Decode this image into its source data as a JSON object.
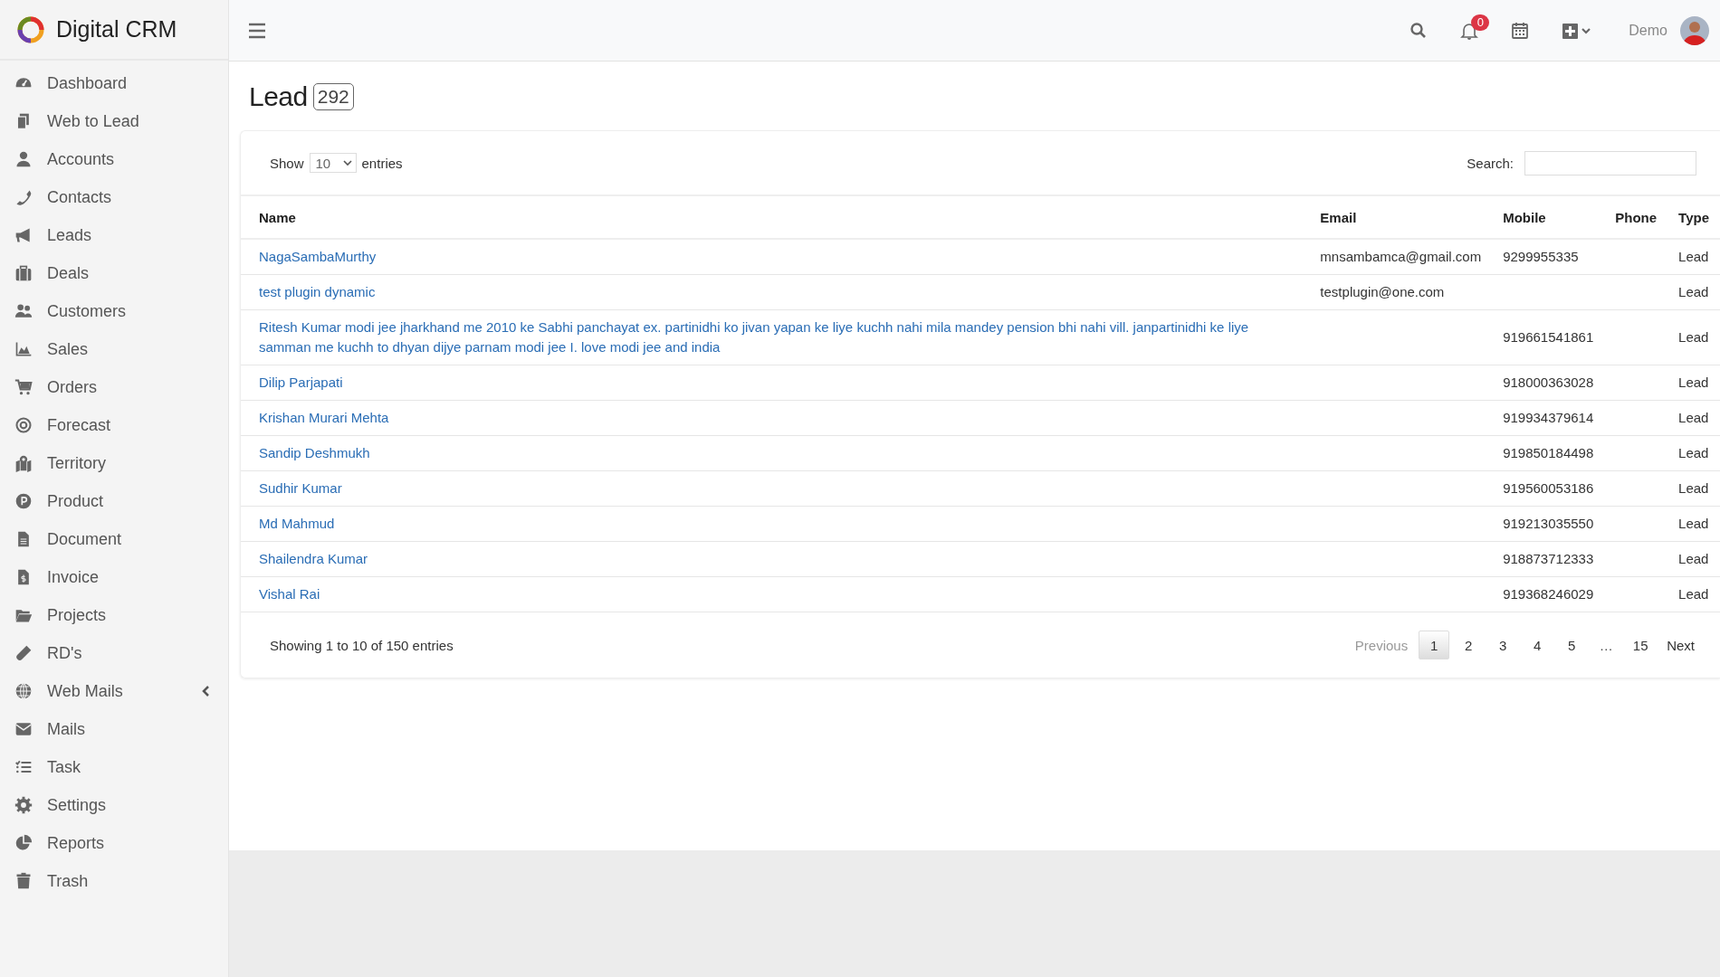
{
  "brand": {
    "title": "Digital CRM"
  },
  "sidebar": {
    "items": [
      {
        "label": "Dashboard",
        "kind": "link"
      },
      {
        "label": "Web to Lead",
        "kind": "link"
      },
      {
        "label": "Accounts",
        "kind": "link"
      },
      {
        "label": "Contacts",
        "kind": "link"
      },
      {
        "label": "Leads",
        "kind": "link"
      },
      {
        "label": "Deals",
        "kind": "link"
      },
      {
        "label": "Customers",
        "kind": "link"
      },
      {
        "label": "Sales",
        "kind": "link"
      },
      {
        "label": "Orders",
        "kind": "link"
      },
      {
        "label": "Forecast",
        "kind": "link"
      },
      {
        "label": "Territory",
        "kind": "link"
      },
      {
        "label": "Product",
        "kind": "link"
      },
      {
        "label": "Document",
        "kind": "link"
      },
      {
        "label": "Invoice",
        "kind": "link"
      },
      {
        "label": "Projects",
        "kind": "link"
      },
      {
        "label": "RD's",
        "kind": "link"
      },
      {
        "label": "Web Mails",
        "kind": "submenu"
      },
      {
        "label": "Mails",
        "kind": "link"
      },
      {
        "label": "Task",
        "kind": "link"
      },
      {
        "label": "Settings",
        "kind": "link"
      },
      {
        "label": "Reports",
        "kind": "link"
      },
      {
        "label": "Trash",
        "kind": "link"
      }
    ]
  },
  "header": {
    "notification_count": "0",
    "user": "Demo"
  },
  "page": {
    "title": "Lead",
    "count": "292"
  },
  "table_controls": {
    "show_label": "Show",
    "page_size": "10",
    "entries_label": "entries",
    "search_label": "Search:"
  },
  "table": {
    "columns": [
      "Name",
      "Email",
      "Mobile",
      "Phone",
      "Type"
    ],
    "rows": [
      {
        "name": "NagaSambaMurthy",
        "email": "mnsambamca@gmail.com",
        "mobile": "9299955335",
        "type": "Lead"
      },
      {
        "name": "test plugin dynamic",
        "email": "testplugin@one.com",
        "type": "Lead"
      },
      {
        "name": "Ritesh Kumar modi jee jharkhand me 2010 ke Sabhi panchayat ex. partinidhi ko jivan yapan ke liye kuchh nahi mila mandey pension bhi nahi vill. janpartinidhi ke liye samman me kuchh to dhyan dijye parnam modi jee I. love modi jee and india",
        "mobile": "919661541861",
        "type": "Lead"
      },
      {
        "name": "Dilip Parjapati",
        "mobile": "918000363028",
        "type": "Lead"
      },
      {
        "name": "Krishan Murari Mehta",
        "mobile": "919934379614",
        "type": "Lead"
      },
      {
        "name": "Sandip Deshmukh",
        "mobile": "919850184498",
        "type": "Lead"
      },
      {
        "name": "Sudhir Kumar",
        "mobile": "919560053186",
        "type": "Lead"
      },
      {
        "name": "Md Mahmud",
        "mobile": "919213035550",
        "type": "Lead"
      },
      {
        "name": "Shailendra Kumar",
        "mobile": "918873712333",
        "type": "Lead"
      },
      {
        "name": "Vishal Rai",
        "mobile": "919368246029",
        "type": "Lead"
      }
    ]
  },
  "footer": {
    "info": "Showing 1 to 10 of 150 entries"
  },
  "pagination": [
    {
      "label": "Previous",
      "kind": "nav",
      "disabled": true,
      "selected": false
    },
    {
      "label": "1",
      "kind": "page",
      "disabled": false,
      "selected": true
    },
    {
      "label": "2",
      "kind": "page",
      "disabled": false,
      "selected": false
    },
    {
      "label": "3",
      "kind": "page",
      "disabled": false,
      "selected": false
    },
    {
      "label": "4",
      "kind": "page",
      "disabled": false,
      "selected": false
    },
    {
      "label": "5",
      "kind": "page",
      "disabled": false,
      "selected": false
    },
    {
      "label": "…",
      "kind": "ellipsis",
      "disabled": false,
      "selected": false
    },
    {
      "label": "15",
      "kind": "page",
      "disabled": false,
      "selected": false
    },
    {
      "label": "Next",
      "kind": "nav",
      "disabled": false,
      "selected": false
    }
  ]
}
